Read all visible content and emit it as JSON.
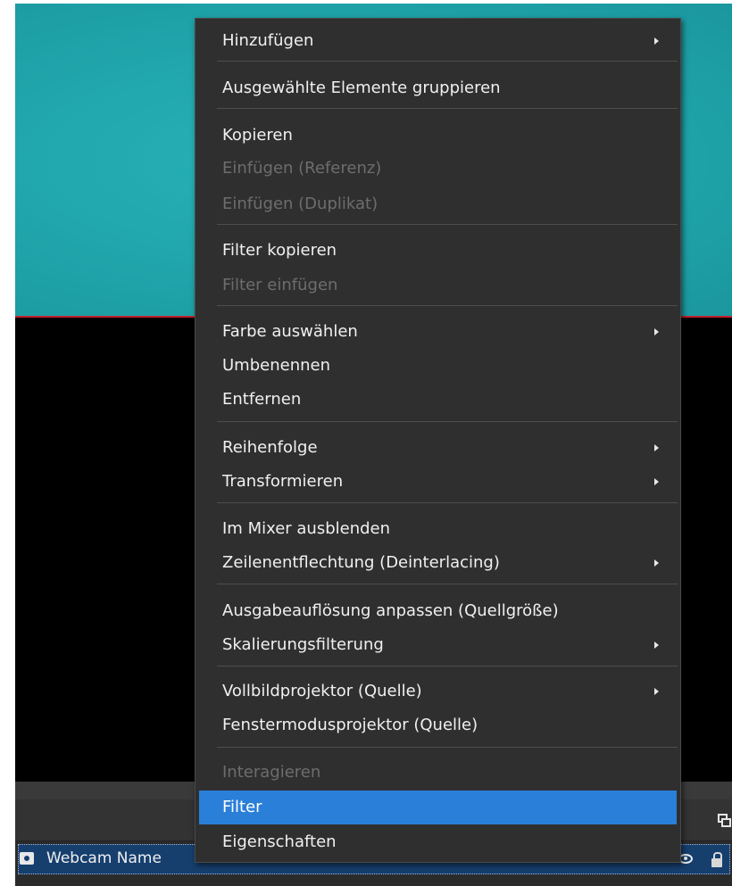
{
  "source_list": {
    "selected_source": "Webcam Name"
  },
  "context_menu": {
    "items": [
      {
        "label": "Hinzufügen",
        "has_submenu": true,
        "disabled": false
      },
      {
        "label": "Ausgewählte Elemente gruppieren",
        "has_submenu": false,
        "disabled": false
      },
      {
        "label": "Kopieren",
        "has_submenu": false,
        "disabled": false
      },
      {
        "label": "Einfügen (Referenz)",
        "has_submenu": false,
        "disabled": true
      },
      {
        "label": "Einfügen (Duplikat)",
        "has_submenu": false,
        "disabled": true
      },
      {
        "label": "Filter kopieren",
        "has_submenu": false,
        "disabled": false
      },
      {
        "label": "Filter einfügen",
        "has_submenu": false,
        "disabled": true
      },
      {
        "label": "Farbe auswählen",
        "has_submenu": true,
        "disabled": false
      },
      {
        "label": "Umbenennen",
        "has_submenu": false,
        "disabled": false
      },
      {
        "label": "Entfernen",
        "has_submenu": false,
        "disabled": false
      },
      {
        "label": "Reihenfolge",
        "has_submenu": true,
        "disabled": false
      },
      {
        "label": "Transformieren",
        "has_submenu": true,
        "disabled": false
      },
      {
        "label": "Im Mixer ausblenden",
        "has_submenu": false,
        "disabled": false
      },
      {
        "label": "Zeilenentflechtung (Deinterlacing)",
        "has_submenu": true,
        "disabled": false
      },
      {
        "label": "Ausgabeauflösung anpassen (Quellgröße)",
        "has_submenu": false,
        "disabled": false
      },
      {
        "label": "Skalierungsfilterung",
        "has_submenu": true,
        "disabled": false
      },
      {
        "label": "Vollbildprojektor (Quelle)",
        "has_submenu": true,
        "disabled": false
      },
      {
        "label": "Fenstermodusprojektor (Quelle)",
        "has_submenu": false,
        "disabled": false
      },
      {
        "label": "Interagieren",
        "has_submenu": false,
        "disabled": true
      },
      {
        "label": "Filter",
        "has_submenu": false,
        "disabled": false,
        "selected": true
      },
      {
        "label": "Eigenschaften",
        "has_submenu": false,
        "disabled": false
      }
    ]
  },
  "colors": {
    "menu_background": "#2f2f2f",
    "highlight": "#2a7fd9",
    "preview_teal": "#21a7ae",
    "selected_row": "#163f6e"
  }
}
